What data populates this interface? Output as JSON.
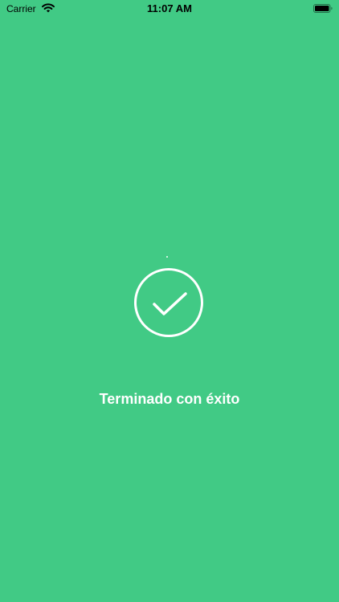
{
  "status_bar": {
    "carrier": "Carrier",
    "time": "11:07 AM",
    "wifi_icon": "wifi-icon",
    "battery_icon": "battery-icon"
  },
  "main": {
    "icon": "checkmark-circle-icon",
    "message": "Terminado con éxito"
  },
  "colors": {
    "background": "#41CA85",
    "foreground": "#FFFFFF",
    "status_text": "#000000"
  }
}
